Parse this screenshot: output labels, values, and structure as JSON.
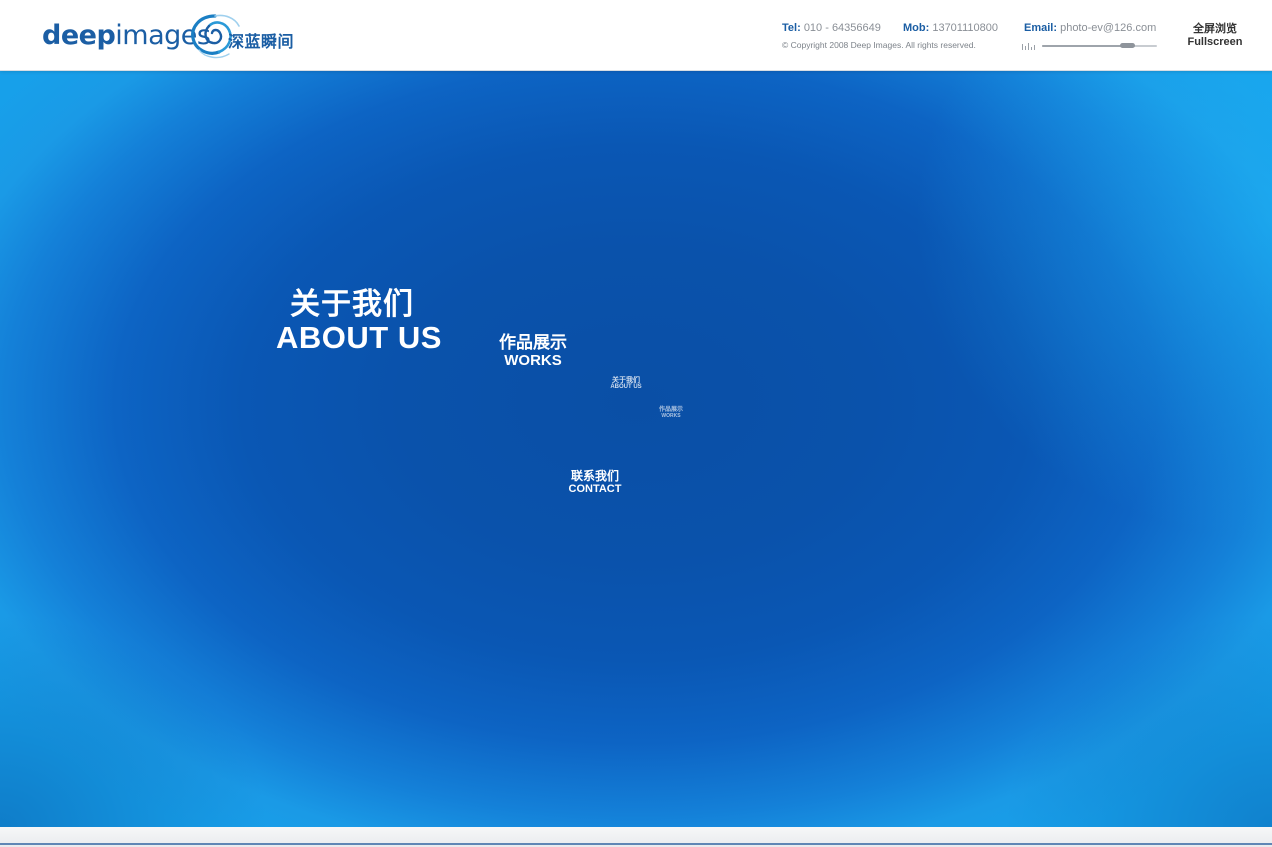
{
  "header": {
    "logo": {
      "word_bold": "deep",
      "word_light": "images",
      "chinese": "深蓝瞬间",
      "icon": "swirl-logo-icon"
    },
    "contact": {
      "tel_label": "Tel:",
      "tel_value": "010 - 64356649",
      "mob_label": "Mob:",
      "mob_value": "13701110800",
      "email_label": "Email:",
      "email_value": "photo-ev@126.com"
    },
    "copyright": "© Copyright 2008 Deep Images. All rights reserved.",
    "volume": {
      "icon": "volume-bars-icon",
      "level": 0.78
    },
    "fullscreen": {
      "cn": "全屏浏览",
      "en": "Fullscreen"
    }
  },
  "nav": {
    "about": {
      "cn": "关于我们",
      "en": "ABOUT US"
    },
    "works": {
      "cn": "作品展示",
      "en": "WORKS"
    },
    "about_small": {
      "cn": "关于我们",
      "en": "ABOUT US"
    },
    "works_small": {
      "cn": "作品展示",
      "en": "WORKS"
    },
    "contact": {
      "cn": "联系我们",
      "en": "CONTACT"
    }
  },
  "colors": {
    "brand": "#1b5ea4",
    "stage_center": "#0a4fa6",
    "stage_edge": "#17a0ea",
    "footer_line": "#5f86b5"
  }
}
